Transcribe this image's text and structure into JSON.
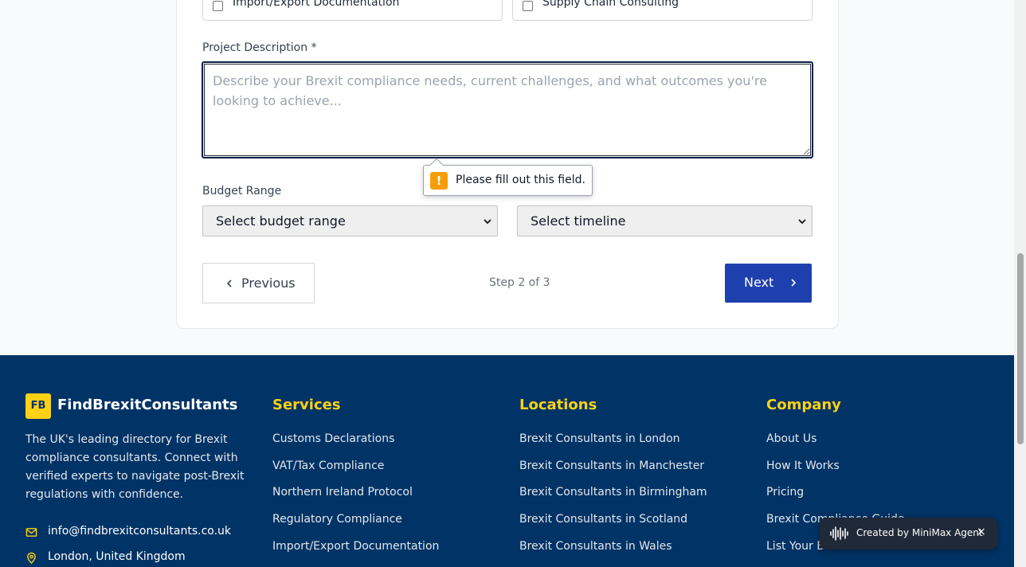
{
  "form": {
    "services": {
      "left_label": "Import/Export Documentation",
      "right_label": "Supply Chain Consulting"
    },
    "description": {
      "label": "Project Description *",
      "placeholder": "Describe your Brexit compliance needs, current challenges, and what outcomes you're looking to achieve...",
      "value": ""
    },
    "validation_tooltip": "Please fill out this field.",
    "budget": {
      "label": "Budget Range",
      "selected": "Select budget range"
    },
    "timeline": {
      "selected": "Select timeline"
    },
    "nav": {
      "previous_label": "Previous",
      "step_text": "Step 2 of 3",
      "next_label": "Next"
    }
  },
  "footer": {
    "logo_text": "FB",
    "brand": "FindBrexitConsultants",
    "about": "The UK's leading directory for Brexit compliance consultants. Connect with verified experts to navigate post-Brexit regulations with confidence.",
    "email": "info@findbrexitconsultants.co.uk",
    "location": "London, United Kingdom",
    "services": {
      "heading": "Services",
      "links": [
        "Customs Declarations",
        "VAT/Tax Compliance",
        "Northern Ireland Protocol",
        "Regulatory Compliance",
        "Import/Export Documentation"
      ]
    },
    "locations": {
      "heading": "Locations",
      "links": [
        "Brexit Consultants in London",
        "Brexit Consultants in Manchester",
        "Brexit Consultants in Birmingham",
        "Brexit Consultants in Scotland",
        "Brexit Consultants in Wales"
      ]
    },
    "company": {
      "heading": "Company",
      "links": [
        "About Us",
        "How It Works",
        "Pricing",
        "Brexit Compliance Guide",
        "List Your Business"
      ]
    }
  },
  "toast": {
    "text": "Created by MiniMax Agent",
    "close": "×"
  },
  "colors": {
    "footer_bg": "#003366",
    "accent_yellow": "#fcd116",
    "primary_button": "#1e40af"
  }
}
